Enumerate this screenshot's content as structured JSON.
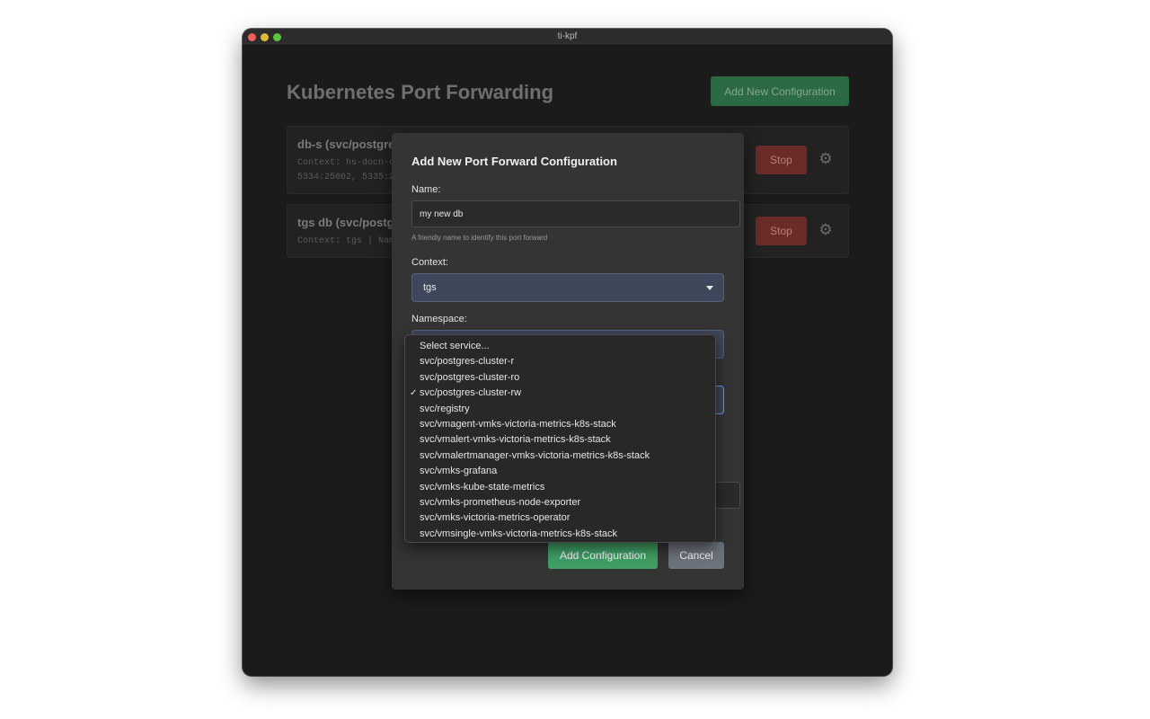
{
  "window": {
    "title": "ti-kpf"
  },
  "app": {
    "title": "Kubernetes Port Forwarding",
    "add_new_label": "Add New Configuration"
  },
  "cards": [
    {
      "title": "db-s (svc/postgres",
      "line1": "Context: hs-docn-c",
      "line2": "5334:25062, 5335:2",
      "stop_label": "Stop"
    },
    {
      "title": "tgs db (svc/postgr",
      "line1": "Context: tgs | Name",
      "stop_label": "Stop"
    }
  ],
  "modal": {
    "title": "Add New Port Forward Configuration",
    "name_label": "Name:",
    "name_value": "my new db",
    "name_hint": "A friendly name to identify this port forward",
    "context_label": "Context:",
    "context_value": "tgs",
    "namespace_label": "Namespace:",
    "add_label": "Add Configuration",
    "cancel_label": "Cancel"
  },
  "dropdown": {
    "selected": "svc/postgres-cluster-rw",
    "options": [
      "Select service...",
      "svc/postgres-cluster-r",
      "svc/postgres-cluster-ro",
      "svc/postgres-cluster-rw",
      "svc/registry",
      "svc/vmagent-vmks-victoria-metrics-k8s-stack",
      "svc/vmalert-vmks-victoria-metrics-k8s-stack",
      "svc/vmalertmanager-vmks-victoria-metrics-k8s-stack",
      "svc/vmks-grafana",
      "svc/vmks-kube-state-metrics",
      "svc/vmks-prometheus-node-exporter",
      "svc/vmks-victoria-metrics-operator",
      "svc/vmsingle-vmks-victoria-metrics-k8s-stack"
    ]
  },
  "icons": {
    "checkmark": "✓",
    "gear": "⚙"
  },
  "colors": {
    "primary_green": "#3f9e64",
    "stop_red": "#6b2b28",
    "select_bg": "#3d475a"
  }
}
